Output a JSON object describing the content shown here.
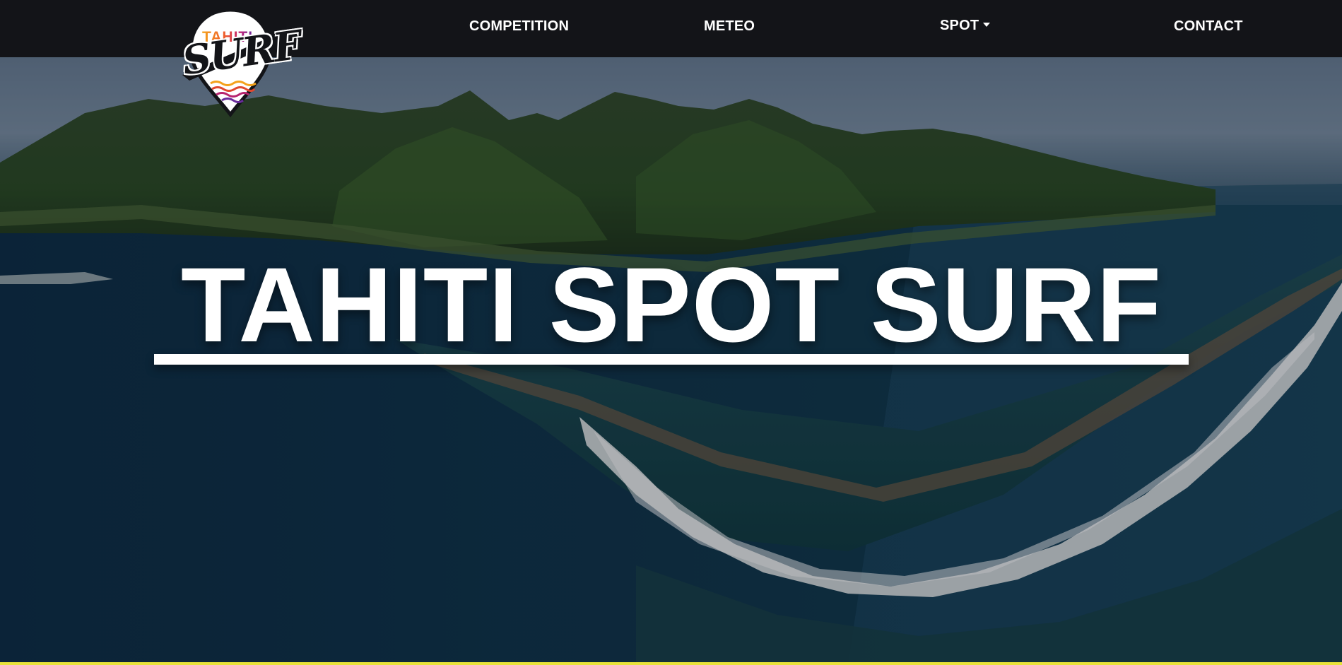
{
  "navbar": {
    "logo": {
      "brand_top": "TAHITI",
      "brand_main": "SURF"
    },
    "links": {
      "competition": "COMPETITION",
      "meteo": "METEO",
      "spot": "SPOT",
      "contact": "CONTACT"
    },
    "spot_dropdown_icon": "caret-down-icon"
  },
  "hero": {
    "title": "TAHITI SPOT SURF",
    "background_description_icon": "island-reef-photo"
  },
  "colors": {
    "navbar_bg": "#131418",
    "nav_text": "#ffffff",
    "title_text": "#ffffff",
    "bottom_strip": "#e8e23a"
  }
}
